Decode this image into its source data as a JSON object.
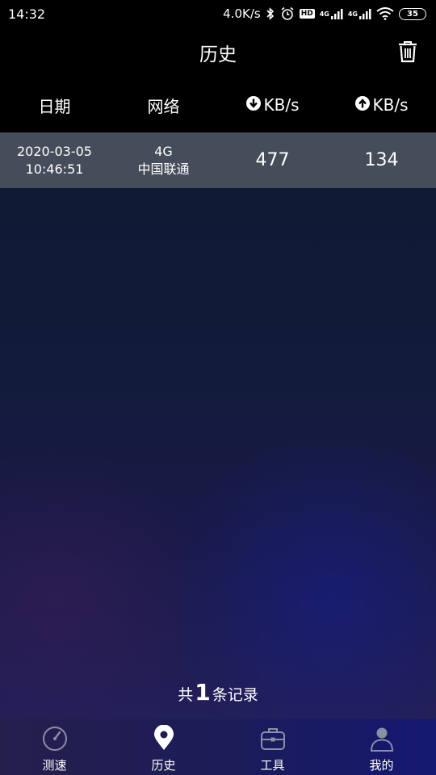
{
  "status_bar": {
    "time": "14:32",
    "speed": "4.0K/s",
    "battery": "35",
    "hd_badge": "HD",
    "net1": "4G",
    "net2": "4G"
  },
  "header": {
    "title": "历史"
  },
  "columns": {
    "date": "日期",
    "network": "网络",
    "download": "KB/s",
    "upload": "KB/s"
  },
  "records": [
    {
      "date": "2020-03-05",
      "time": "10:46:51",
      "network_type": "4G",
      "carrier": "中国联通",
      "download": "477",
      "upload": "134"
    }
  ],
  "summary": {
    "prefix": "共",
    "count": "1",
    "suffix": "条记录"
  },
  "nav": {
    "items": [
      {
        "label": "测速",
        "icon": "speedometer-icon"
      },
      {
        "label": "历史",
        "icon": "location-pin-icon"
      },
      {
        "label": "工具",
        "icon": "toolbox-icon"
      },
      {
        "label": "我的",
        "icon": "person-icon"
      }
    ]
  }
}
